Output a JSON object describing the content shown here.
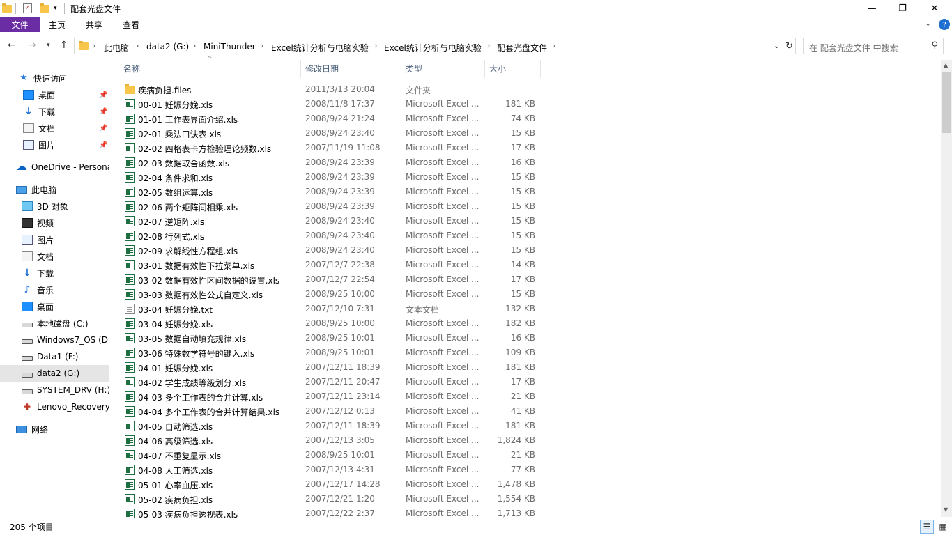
{
  "window": {
    "title": "配套光盘文件",
    "controls": {
      "minimize": "—",
      "maximize": "❐",
      "close": "✕"
    }
  },
  "ribbon": {
    "tabs": [
      "文件",
      "主页",
      "共享",
      "查看"
    ],
    "help": "?"
  },
  "address": {
    "crumbs": [
      "此电脑",
      "data2 (G:)",
      "MiniThunder",
      "Excel统计分析与电脑实验",
      "Excel统计分析与电脑实验",
      "配套光盘文件"
    ],
    "search_placeholder": "在 配套光盘文件 中搜索"
  },
  "nav": {
    "quick_access": "快速访问",
    "quick_items": [
      "桌面",
      "下载",
      "文档",
      "图片"
    ],
    "onedrive": "OneDrive - Persona",
    "this_pc": "此电脑",
    "pc_items": [
      "3D 对象",
      "视频",
      "图片",
      "文档",
      "下载",
      "音乐",
      "桌面"
    ],
    "drives": [
      "本地磁盘 (C:)",
      "Windows7_OS (D:",
      "Data1 (F:)",
      "data2 (G:)",
      "SYSTEM_DRV (H:)",
      "Lenovo_Recovery"
    ],
    "network": "网络"
  },
  "columns": {
    "name": "名称",
    "date": "修改日期",
    "type": "类型",
    "size": "大小"
  },
  "files": [
    {
      "icon": "folder",
      "name": "疾病负担.files",
      "date": "2011/3/13 20:04",
      "type": "文件夹",
      "size": ""
    },
    {
      "icon": "xls",
      "name": "00-01 妊娠分娩.xls",
      "date": "2008/11/8 17:37",
      "type": "Microsoft Excel ...",
      "size": "181 KB"
    },
    {
      "icon": "xls",
      "name": "01-01 工作表界面介绍.xls",
      "date": "2008/9/24 21:24",
      "type": "Microsoft Excel ...",
      "size": "74 KB"
    },
    {
      "icon": "xls",
      "name": "02-01 乘法口诀表.xls",
      "date": "2008/9/24 23:40",
      "type": "Microsoft Excel ...",
      "size": "15 KB"
    },
    {
      "icon": "xls",
      "name": "02-02 四格表卡方检验理论频数.xls",
      "date": "2007/11/19 11:08",
      "type": "Microsoft Excel ...",
      "size": "17 KB"
    },
    {
      "icon": "xls",
      "name": "02-03 数据取舍函数.xls",
      "date": "2008/9/24 23:39",
      "type": "Microsoft Excel ...",
      "size": "16 KB"
    },
    {
      "icon": "xls",
      "name": "02-04 条件求和.xls",
      "date": "2008/9/24 23:39",
      "type": "Microsoft Excel ...",
      "size": "15 KB"
    },
    {
      "icon": "xls",
      "name": "02-05 数组运算.xls",
      "date": "2008/9/24 23:39",
      "type": "Microsoft Excel ...",
      "size": "15 KB"
    },
    {
      "icon": "xls",
      "name": "02-06 两个矩阵间相乘.xls",
      "date": "2008/9/24 23:39",
      "type": "Microsoft Excel ...",
      "size": "15 KB"
    },
    {
      "icon": "xls",
      "name": "02-07 逆矩阵.xls",
      "date": "2008/9/24 23:40",
      "type": "Microsoft Excel ...",
      "size": "15 KB"
    },
    {
      "icon": "xls",
      "name": "02-08 行列式.xls",
      "date": "2008/9/24 23:40",
      "type": "Microsoft Excel ...",
      "size": "15 KB"
    },
    {
      "icon": "xls",
      "name": "02-09 求解线性方程组.xls",
      "date": "2008/9/24 23:40",
      "type": "Microsoft Excel ...",
      "size": "15 KB"
    },
    {
      "icon": "xls",
      "name": "03-01 数据有效性下拉菜单.xls",
      "date": "2007/12/7 22:38",
      "type": "Microsoft Excel ...",
      "size": "14 KB"
    },
    {
      "icon": "xls",
      "name": "03-02 数据有效性区间数据的设置.xls",
      "date": "2007/12/7 22:54",
      "type": "Microsoft Excel ...",
      "size": "17 KB"
    },
    {
      "icon": "xls",
      "name": "03-03 数据有效性公式自定义.xls",
      "date": "2008/9/25 10:00",
      "type": "Microsoft Excel ...",
      "size": "15 KB"
    },
    {
      "icon": "txt",
      "name": "03-04 妊娠分娩.txt",
      "date": "2007/12/10 7:31",
      "type": "文本文档",
      "size": "132 KB"
    },
    {
      "icon": "xls",
      "name": "03-04 妊娠分娩.xls",
      "date": "2008/9/25 10:00",
      "type": "Microsoft Excel ...",
      "size": "182 KB"
    },
    {
      "icon": "xls",
      "name": "03-05 数据自动填充规律.xls",
      "date": "2008/9/25 10:01",
      "type": "Microsoft Excel ...",
      "size": "16 KB"
    },
    {
      "icon": "xls",
      "name": "03-06 特殊数学符号的键入.xls",
      "date": "2008/9/25 10:01",
      "type": "Microsoft Excel ...",
      "size": "109 KB"
    },
    {
      "icon": "xls",
      "name": "04-01 妊娠分娩.xls",
      "date": "2007/12/11 18:39",
      "type": "Microsoft Excel ...",
      "size": "181 KB"
    },
    {
      "icon": "xls",
      "name": "04-02 学生成绩等级划分.xls",
      "date": "2007/12/11 20:47",
      "type": "Microsoft Excel ...",
      "size": "17 KB"
    },
    {
      "icon": "xls",
      "name": "04-03 多个工作表的合并计算.xls",
      "date": "2007/12/11 23:14",
      "type": "Microsoft Excel ...",
      "size": "21 KB"
    },
    {
      "icon": "xls",
      "name": "04-04 多个工作表的合并计算结果.xls",
      "date": "2007/12/12 0:13",
      "type": "Microsoft Excel ...",
      "size": "41 KB"
    },
    {
      "icon": "xls",
      "name": "04-05 自动筛选.xls",
      "date": "2007/12/11 18:39",
      "type": "Microsoft Excel ...",
      "size": "181 KB"
    },
    {
      "icon": "xls",
      "name": "04-06 高级筛选.xls",
      "date": "2007/12/13 3:05",
      "type": "Microsoft Excel ...",
      "size": "1,824 KB"
    },
    {
      "icon": "xls",
      "name": "04-07 不重复显示.xls",
      "date": "2008/9/25 10:01",
      "type": "Microsoft Excel ...",
      "size": "21 KB"
    },
    {
      "icon": "xls",
      "name": "04-08 人工筛选.xls",
      "date": "2007/12/13 4:31",
      "type": "Microsoft Excel ...",
      "size": "77 KB"
    },
    {
      "icon": "xls",
      "name": "05-01 心率血压.xls",
      "date": "2007/12/17 14:28",
      "type": "Microsoft Excel ...",
      "size": "1,478 KB"
    },
    {
      "icon": "xls",
      "name": "05-02 疾病负担.xls",
      "date": "2007/12/21 1:20",
      "type": "Microsoft Excel ...",
      "size": "1,554 KB"
    },
    {
      "icon": "xls",
      "name": "05-03 疾病负担透视表.xls",
      "date": "2007/12/22 2:37",
      "type": "Microsoft Excel ...",
      "size": "1,713 KB"
    }
  ],
  "status": {
    "count": "205 个项目"
  },
  "colors": {
    "accent": "#6b2da4",
    "selected": "#cce8ff"
  }
}
